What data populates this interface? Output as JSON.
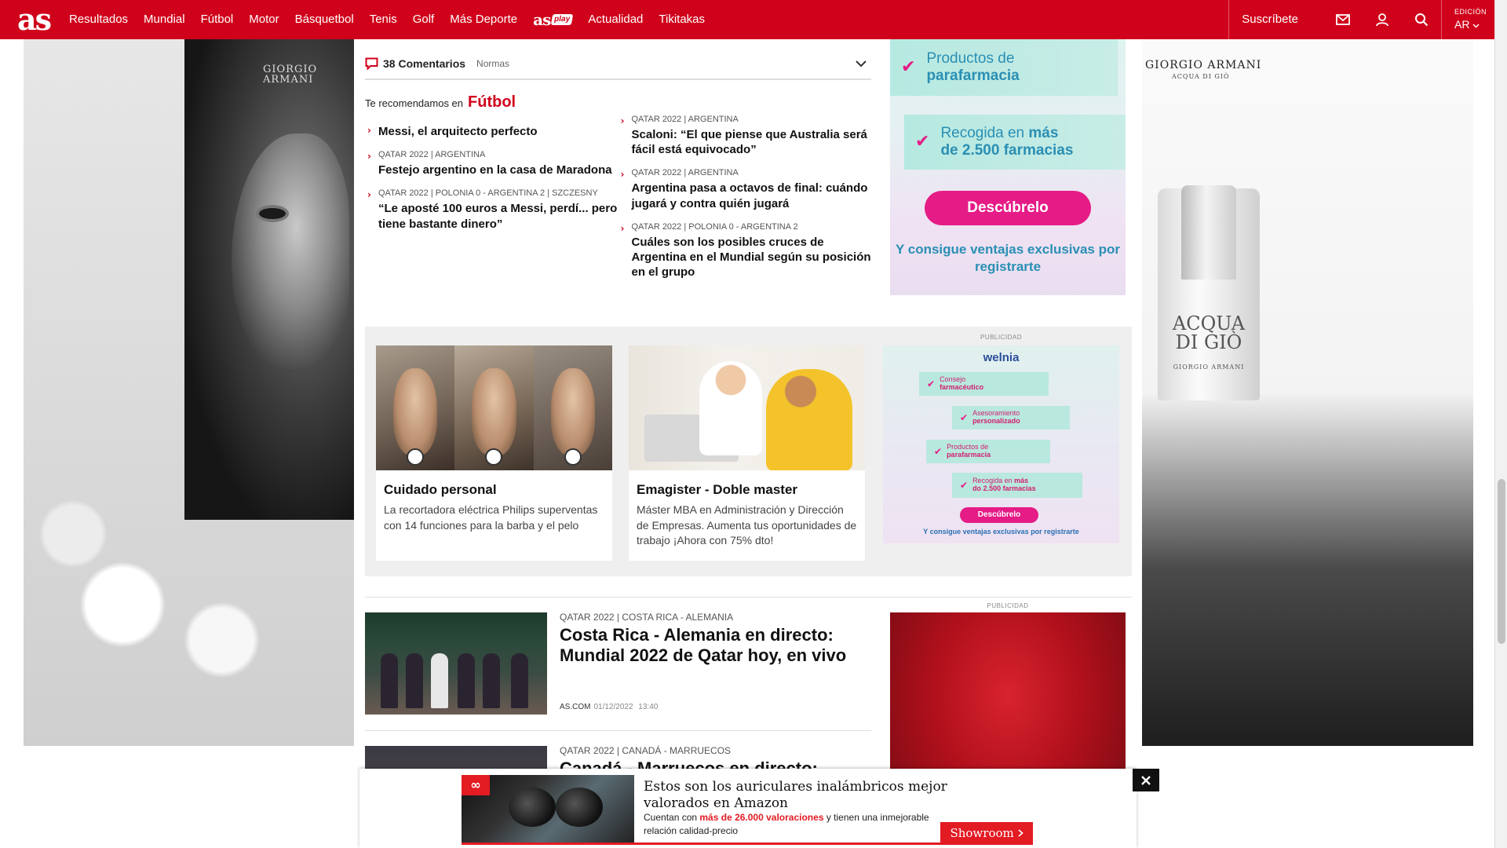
{
  "header": {
    "logo": "as",
    "nav": [
      "Resultados",
      "Mundial",
      "Fútbol",
      "Motor",
      "Básquetbol",
      "Tenis",
      "Golf",
      "Más Deporte"
    ],
    "asplay_logo": "as",
    "asplay_tag": "play",
    "nav_after": [
      "Actualidad",
      "Tikitakas"
    ],
    "subscribe": "Suscríbete",
    "edition_label": "EDICIÓN",
    "edition_value": "AR"
  },
  "skin": {
    "left_brand": "GIORGIO ARMANI",
    "right_brand": "GIORGIO ARMANI",
    "right_sub": "ACQUA DI GIÒ",
    "bottle_name": "ACQUA DI GIÒ",
    "bottle_brand": "GIORGIO ARMANI"
  },
  "comments": {
    "count": "38 Comentarios",
    "rules": "Normas"
  },
  "recommend": {
    "lead": "Te recomendamos en",
    "section": "Fútbol",
    "left": [
      {
        "kicker": "",
        "title": "Messi, el arquitecto perfecto"
      },
      {
        "kicker": "QATAR 2022 | ARGENTINA",
        "title": "Festejo argentino en la casa de Maradona"
      },
      {
        "kicker": "QATAR 2022 | POLONIA 0 - ARGENTINA 2 | SZCZESNY",
        "title": "“Le aposté 100 euros a Messi, perdí... pero tiene bastante dinero”"
      }
    ],
    "right": [
      {
        "kicker": "QATAR 2022 | ARGENTINA",
        "title": "Scaloni: “El que piense que Australia será fácil está equivocado”"
      },
      {
        "kicker": "QATAR 2022 | ARGENTINA",
        "title": "Argentina pasa a octavos de final: cuándo jugará y contra quién jugará"
      },
      {
        "kicker": "QATAR 2022 | POLONIA 0 - ARGENTINA 2",
        "title": "Cuáles son los posibles cruces de Argentina en el Mundial según su posición en el grupo"
      }
    ]
  },
  "side_ad": {
    "pill1_a": "Productos de",
    "pill1_b": "parafarmacia",
    "pill2_a": "Recogida en ",
    "pill2_bold": "más",
    "pill2_b": "de 2.500 farmacias",
    "button": "Descúbrelo",
    "tagline": "Y consigue ventajas exclusivas por registrarte"
  },
  "promo": {
    "cards": [
      {
        "title": "Cuidado personal",
        "desc": "La recortadora eléctrica Philips superventas con 14 funciones para la barba y el pelo"
      },
      {
        "title": "Emagister - Doble master",
        "desc": "Máster MBA en Administración y Dirección de Empresas. Aumenta tus oportunidades de trabajo ¡Ahora con 75% dto!"
      }
    ],
    "ad": {
      "label": "PUBLICIDAD",
      "logo": "welnia",
      "pill1_a": "Consejo",
      "pill1_b": "farmacéutico",
      "pill2_a": "Asesoramiento",
      "pill2_b": "personalizado",
      "pill3_a": "Productos de",
      "pill3_b": "parafarmacia",
      "pill4_a": "Recogida en ",
      "pill4_bold": "más",
      "pill4_b": "do 2.500 farmacias",
      "button": "Descúbrelo",
      "tagline": "Y consigue ventajas exclusivas por registrarte"
    }
  },
  "articles": [
    {
      "kicker": "QATAR 2022 | COSTA RICA - ALEMANIA",
      "title": "Costa Rica - Alemania en directo: Mundial 2022 de Qatar hoy, en vivo",
      "source": "AS.COM",
      "date": "01/12/2022",
      "time": "13:40"
    },
    {
      "kicker": "QATAR 2022 | CANADÁ - MARRUECOS",
      "title": "Canadá - Marruecos en directo:",
      "source": "",
      "date": "",
      "time": ""
    }
  ],
  "pub_right": "PUBLICIDAD",
  "sticky_ad": {
    "title": "Estos son los auriculares inalámbricos mejor valorados en Amazon",
    "desc_a": "Cuentan con ",
    "desc_hl": "más de 26.000 valoraciones",
    "desc_b": " y tienen una inmejorable relación calidad-precio",
    "button": "Showroom"
  }
}
